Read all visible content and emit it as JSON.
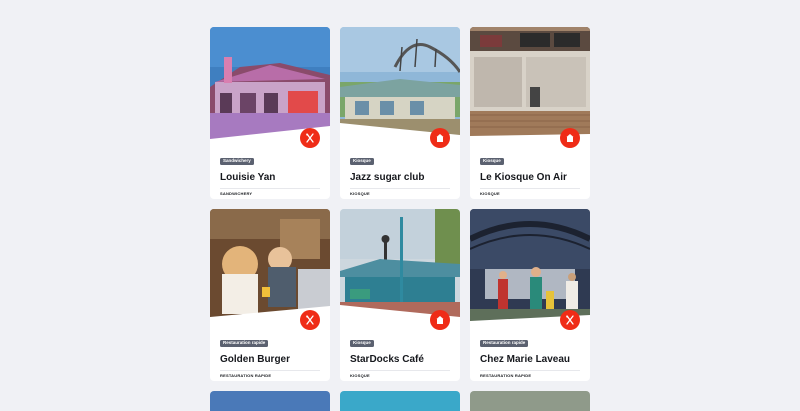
{
  "colors": {
    "accent": "#ef2c17",
    "tag_bg": "#5b6170",
    "page_bg": "#f0f1f5"
  },
  "cards": [
    {
      "tag": "Sandwichery",
      "title": "Louisie Yan",
      "category": "SANDWICHERY",
      "icon": "cutlery-icon"
    },
    {
      "tag": "Kiosque",
      "title": "Jazz sugar club",
      "category": "KIOSQUE",
      "icon": "kiosk-icon"
    },
    {
      "tag": "Kiosque",
      "title": "Le Kiosque On Air",
      "category": "KIOSQUE",
      "icon": "kiosk-icon"
    },
    {
      "tag": "Restauration rapide",
      "title": "Golden Burger",
      "category": "RESTAURATION RAPIDE",
      "icon": "cutlery-icon"
    },
    {
      "tag": "Kiosque",
      "title": "StarDocks Café",
      "category": "KIOSQUE",
      "icon": "kiosk-icon"
    },
    {
      "tag": "Restauration rapide",
      "title": "Chez Marie Laveau",
      "category": "RESTAURATION RAPIDE",
      "icon": "cutlery-icon"
    }
  ]
}
